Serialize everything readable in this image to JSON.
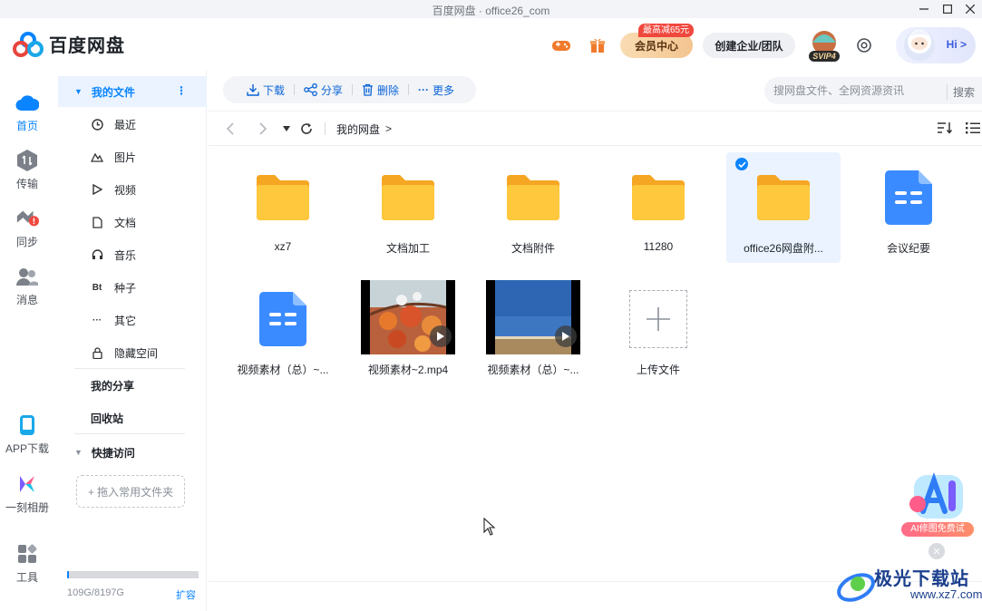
{
  "window": {
    "title": "百度网盘 · office26_com"
  },
  "header": {
    "app_name": "百度网盘",
    "vip_label": "会员中心",
    "vip_badge": "最高减65元",
    "team_label": "创建企业/团队",
    "svip_label": "SVIP4",
    "hi_label": "Hi >",
    "icons": [
      "gamepad-icon",
      "gift-icon",
      "settings-icon"
    ]
  },
  "nav": {
    "items": [
      {
        "label": "首页",
        "icon": "cloud-icon",
        "active": true
      },
      {
        "label": "传输",
        "icon": "transfer-icon"
      },
      {
        "label": "同步",
        "icon": "sync-icon"
      },
      {
        "label": "消息",
        "icon": "message-icon"
      },
      {
        "label": "APP下载",
        "icon": "phone-icon"
      },
      {
        "label": "一刻相册",
        "icon": "album-icon"
      },
      {
        "label": "工具",
        "icon": "tools-icon"
      }
    ]
  },
  "sidebar": {
    "my_files": "我的文件",
    "items": [
      {
        "label": "最近",
        "icon": "clock-icon"
      },
      {
        "label": "图片",
        "icon": "image-icon"
      },
      {
        "label": "视频",
        "icon": "play-icon"
      },
      {
        "label": "文档",
        "icon": "doc-icon"
      },
      {
        "label": "音乐",
        "icon": "headphone-icon"
      },
      {
        "label": "种子",
        "icon": "bt-icon",
        "glyph": "Bt"
      },
      {
        "label": "其它",
        "icon": "more-icon"
      },
      {
        "label": "隐藏空间",
        "icon": "lock-icon"
      }
    ],
    "my_share": "我的分享",
    "recycle_bin": "回收站",
    "quick_access": "快捷访问",
    "drop_hint": "+ 拖入常用文件夹",
    "storage_text": "109G/8197G",
    "storage_fraction": 0.013,
    "expand_label": "扩容"
  },
  "toolbar": {
    "download": "下载",
    "share": "分享",
    "delete": "删除",
    "more": "更多"
  },
  "search": {
    "placeholder": "搜网盘文件、全网资源资讯",
    "button": "搜索"
  },
  "path": {
    "crumb": "我的网盘",
    "sep": ">"
  },
  "files": [
    {
      "name": "xz7",
      "type": "folder"
    },
    {
      "name": "文档加工",
      "type": "folder"
    },
    {
      "name": "文档附件",
      "type": "folder"
    },
    {
      "name": "11280",
      "type": "folder"
    },
    {
      "name": "office26网盘附...",
      "type": "folder",
      "selected": true
    },
    {
      "name": "会议纪要",
      "type": "doc"
    },
    {
      "name": "视频素材（总）~...",
      "type": "doc"
    },
    {
      "name": "视频素材~2.mp4",
      "type": "video"
    },
    {
      "name": "视频素材（总）~...",
      "type": "video"
    },
    {
      "name": "上传文件",
      "type": "upload"
    }
  ],
  "ai_widget": {
    "label": "AI修图免费试"
  },
  "watermark": {
    "title": "极光下载站",
    "sub": "www.xz7.com"
  }
}
